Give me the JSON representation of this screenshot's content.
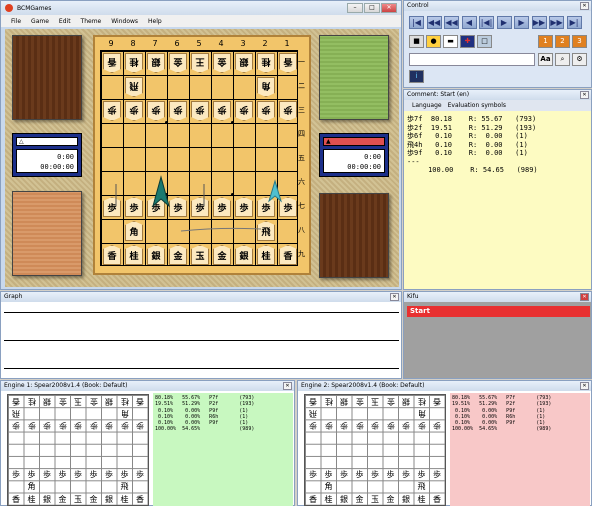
{
  "app": {
    "title": "BCMGames",
    "menu": [
      "File",
      "Game",
      "Edit",
      "Theme",
      "Windows",
      "Help"
    ],
    "window_buttons": [
      "–",
      "□",
      "✕"
    ]
  },
  "board": {
    "files": [
      "9",
      "8",
      "7",
      "6",
      "5",
      "4",
      "3",
      "2",
      "1"
    ],
    "ranks": [
      "一",
      "二",
      "三",
      "四",
      "五",
      "六",
      "七",
      "八",
      "九"
    ],
    "gote_back": [
      "香",
      "桂",
      "銀",
      "金",
      "王",
      "金",
      "銀",
      "桂",
      "香"
    ],
    "gote_rook": "飛",
    "gote_bishop": "角",
    "gote_pawns": [
      "歩",
      "歩",
      "歩",
      "歩",
      "歩",
      "歩",
      "歩",
      "歩",
      "歩"
    ],
    "sente_pawns": [
      "歩",
      "歩",
      "歩",
      "歩",
      "歩",
      "歩",
      "歩",
      "歩",
      "歩"
    ],
    "sente_bishop": "角",
    "sente_rook": "飛",
    "sente_back": [
      "香",
      "桂",
      "銀",
      "金",
      "玉",
      "金",
      "銀",
      "桂",
      "香"
    ]
  },
  "clock_left": {
    "marker": "△",
    "time1": "0:00",
    "time2": "00:00:00",
    "color": "#ffffff"
  },
  "clock_right": {
    "marker": "▲",
    "time1": "0:00",
    "time2": "00:00:00",
    "color": "#e05050"
  },
  "control": {
    "title": "Control",
    "nav_buttons": [
      "|◀",
      "◀◀",
      "◀◀",
      "◀",
      "|◀|",
      "▶",
      "▶",
      "▶▶",
      "▶▶",
      "▶|"
    ],
    "tool_buttons": [
      "■",
      "●",
      "▬",
      "✚",
      "□"
    ],
    "page_buttons": [
      "1",
      "2",
      "3"
    ],
    "font_button": "Aa"
  },
  "comment": {
    "title": "Comment: Start (en)",
    "tabs": [
      "Language",
      "Evaluation symbols"
    ],
    "lines": [
      "歩7f  80.18    R: 55.67   (793)",
      "歩2f  19.51    R: 51.29   (193)",
      "歩6f   0.10    R:  0.00   (1)",
      "飛4h   0.10    R:  0.00   (1)",
      "歩9f   0.10    R:  0.00   (1)",
      "---",
      "     100.00    R: 54.65   (989)"
    ]
  },
  "graph": {
    "title": "Graph"
  },
  "kifu": {
    "title": "Kifu",
    "entry": "Start"
  },
  "engine1": {
    "title": "Engine 1: Spear2008v1.4  (Book: Default)",
    "color": "#c8f8c0",
    "lines": [
      "80.18%   55.67%   P7f       (793)",
      "19.51%   51.29%   P2f       (193)",
      " 0.10%    0.00%   P9f       (1)",
      " 0.10%    0.00%   R6h       (1)",
      " 0.10%    0.00%   P9f       (1)",
      "",
      "100.00%  54.65%             (989)"
    ]
  },
  "engine2": {
    "title": "Engine 2: Spear2008v1.4  (Book: Default)",
    "color": "#f8c8c8",
    "lines": [
      "80.18%   55.67%   P7f       (793)",
      "19.51%   51.29%   P2f       (193)",
      " 0.10%    0.00%   P9f       (1)",
      " 0.10%    0.00%   R6h       (1)",
      " 0.10%    0.00%   P9f       (1)",
      "",
      "100.00%  54.65%             (989)"
    ]
  },
  "mini_board": {
    "row1": [
      "香",
      "桂",
      "銀",
      "金",
      "玉",
      "金",
      "銀",
      "桂",
      "香"
    ],
    "row2": [
      "飛",
      "",
      "",
      "",
      "",
      "",
      "",
      "角",
      ""
    ],
    "row3": [
      "歩",
      "歩",
      "歩",
      "歩",
      "歩",
      "歩",
      "歩",
      "歩",
      "歩"
    ],
    "row7": [
      "歩",
      "歩",
      "歩",
      "歩",
      "歩",
      "歩",
      "歩",
      "歩",
      "歩"
    ],
    "row8": [
      "",
      "角",
      "",
      "",
      "",
      "",
      "",
      "飛",
      ""
    ],
    "row9": [
      "香",
      "桂",
      "銀",
      "金",
      "玉",
      "金",
      "銀",
      "桂",
      "香"
    ]
  }
}
